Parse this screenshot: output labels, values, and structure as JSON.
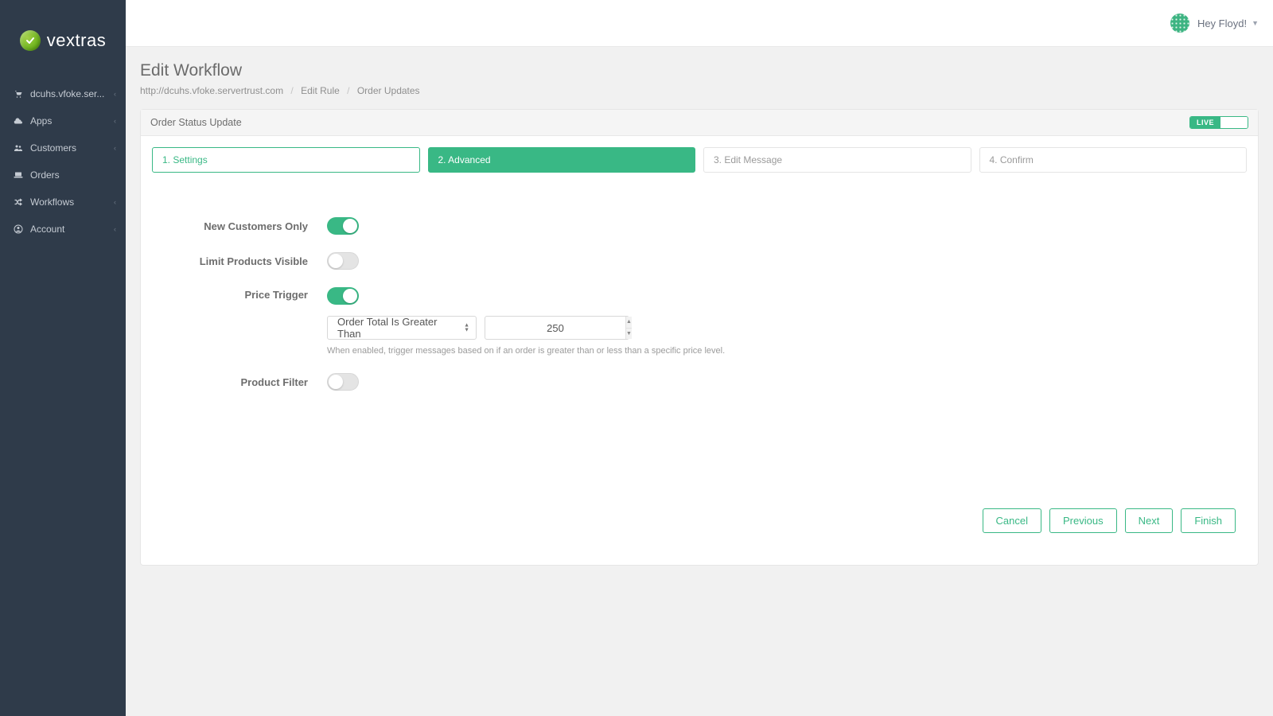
{
  "brand": {
    "name": "vextras"
  },
  "sidebar": {
    "items": [
      {
        "label": "dcuhs.vfoke.ser...",
        "icon": "cart-icon",
        "hasChevron": true
      },
      {
        "label": "Apps",
        "icon": "cloud-icon",
        "hasChevron": true
      },
      {
        "label": "Customers",
        "icon": "users-icon",
        "hasChevron": true
      },
      {
        "label": "Orders",
        "icon": "laptop-icon",
        "hasChevron": false
      },
      {
        "label": "Workflows",
        "icon": "shuffle-icon",
        "hasChevron": true
      },
      {
        "label": "Account",
        "icon": "user-circle-icon",
        "hasChevron": true
      }
    ]
  },
  "topbar": {
    "greeting": "Hey Floyd!"
  },
  "page": {
    "title": "Edit Workflow",
    "breadcrumbs": [
      "http://dcuhs.vfoke.servertrust.com",
      "Edit Rule",
      "Order Updates"
    ]
  },
  "panel": {
    "title": "Order Status Update",
    "live_label": "LIVE"
  },
  "steps": {
    "items": [
      {
        "label": "1. Settings",
        "state": "completed"
      },
      {
        "label": "2. Advanced",
        "state": "active"
      },
      {
        "label": "3. Edit Message",
        "state": "default"
      },
      {
        "label": "4. Confirm",
        "state": "default"
      }
    ]
  },
  "form": {
    "newCustomersOnly": {
      "label": "New Customers Only",
      "value": true
    },
    "limitProductsVisible": {
      "label": "Limit Products Visible",
      "value": false
    },
    "priceTrigger": {
      "label": "Price Trigger",
      "value": true,
      "comparison": "Order Total Is Greater Than",
      "amount": "250",
      "help": "When enabled, trigger messages based on if an order is greater than or less than a specific price level."
    },
    "productFilter": {
      "label": "Product Filter",
      "value": false
    }
  },
  "buttons": {
    "cancel": "Cancel",
    "previous": "Previous",
    "next": "Next",
    "finish": "Finish"
  }
}
